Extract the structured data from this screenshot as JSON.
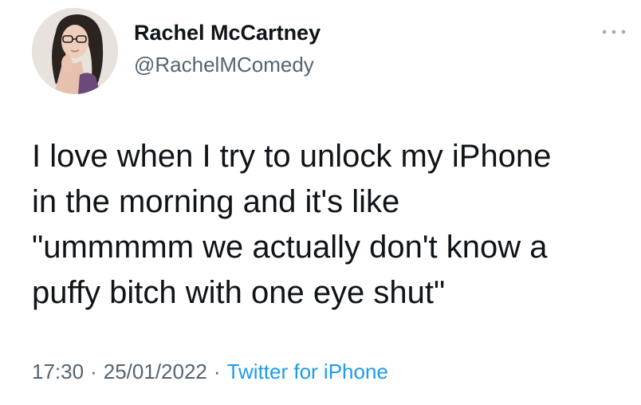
{
  "author": {
    "display_name": "Rachel McCartney",
    "handle": "@RachelMComedy",
    "avatar_icon": "profile-photo"
  },
  "more_icon": "more-dots-icon",
  "tweet": {
    "lines": [
      "I love when I try to unlock my iPhone",
      "in the morning and it's like",
      "\"ummmmm we actually don't know a",
      "puffy bitch with one eye shut\""
    ]
  },
  "meta": {
    "time": "17:30",
    "separator": "·",
    "date": "25/01/2022",
    "source": "Twitter for iPhone"
  },
  "colors": {
    "text": "#0f1419",
    "secondary": "#536471",
    "link": "#1d9bf0"
  }
}
